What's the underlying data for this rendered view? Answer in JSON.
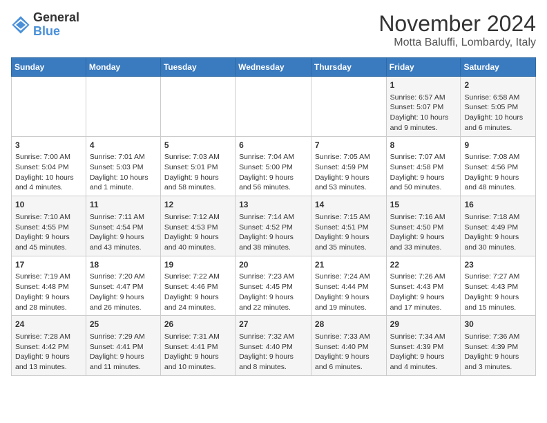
{
  "logo": {
    "line1": "General",
    "line2": "Blue"
  },
  "title": "November 2024",
  "location": "Motta Baluffi, Lombardy, Italy",
  "days_of_week": [
    "Sunday",
    "Monday",
    "Tuesday",
    "Wednesday",
    "Thursday",
    "Friday",
    "Saturday"
  ],
  "weeks": [
    [
      {
        "day": "",
        "info": ""
      },
      {
        "day": "",
        "info": ""
      },
      {
        "day": "",
        "info": ""
      },
      {
        "day": "",
        "info": ""
      },
      {
        "day": "",
        "info": ""
      },
      {
        "day": "1",
        "info": "Sunrise: 6:57 AM\nSunset: 5:07 PM\nDaylight: 10 hours and 9 minutes."
      },
      {
        "day": "2",
        "info": "Sunrise: 6:58 AM\nSunset: 5:05 PM\nDaylight: 10 hours and 6 minutes."
      }
    ],
    [
      {
        "day": "3",
        "info": "Sunrise: 7:00 AM\nSunset: 5:04 PM\nDaylight: 10 hours and 4 minutes."
      },
      {
        "day": "4",
        "info": "Sunrise: 7:01 AM\nSunset: 5:03 PM\nDaylight: 10 hours and 1 minute."
      },
      {
        "day": "5",
        "info": "Sunrise: 7:03 AM\nSunset: 5:01 PM\nDaylight: 9 hours and 58 minutes."
      },
      {
        "day": "6",
        "info": "Sunrise: 7:04 AM\nSunset: 5:00 PM\nDaylight: 9 hours and 56 minutes."
      },
      {
        "day": "7",
        "info": "Sunrise: 7:05 AM\nSunset: 4:59 PM\nDaylight: 9 hours and 53 minutes."
      },
      {
        "day": "8",
        "info": "Sunrise: 7:07 AM\nSunset: 4:58 PM\nDaylight: 9 hours and 50 minutes."
      },
      {
        "day": "9",
        "info": "Sunrise: 7:08 AM\nSunset: 4:56 PM\nDaylight: 9 hours and 48 minutes."
      }
    ],
    [
      {
        "day": "10",
        "info": "Sunrise: 7:10 AM\nSunset: 4:55 PM\nDaylight: 9 hours and 45 minutes."
      },
      {
        "day": "11",
        "info": "Sunrise: 7:11 AM\nSunset: 4:54 PM\nDaylight: 9 hours and 43 minutes."
      },
      {
        "day": "12",
        "info": "Sunrise: 7:12 AM\nSunset: 4:53 PM\nDaylight: 9 hours and 40 minutes."
      },
      {
        "day": "13",
        "info": "Sunrise: 7:14 AM\nSunset: 4:52 PM\nDaylight: 9 hours and 38 minutes."
      },
      {
        "day": "14",
        "info": "Sunrise: 7:15 AM\nSunset: 4:51 PM\nDaylight: 9 hours and 35 minutes."
      },
      {
        "day": "15",
        "info": "Sunrise: 7:16 AM\nSunset: 4:50 PM\nDaylight: 9 hours and 33 minutes."
      },
      {
        "day": "16",
        "info": "Sunrise: 7:18 AM\nSunset: 4:49 PM\nDaylight: 9 hours and 30 minutes."
      }
    ],
    [
      {
        "day": "17",
        "info": "Sunrise: 7:19 AM\nSunset: 4:48 PM\nDaylight: 9 hours and 28 minutes."
      },
      {
        "day": "18",
        "info": "Sunrise: 7:20 AM\nSunset: 4:47 PM\nDaylight: 9 hours and 26 minutes."
      },
      {
        "day": "19",
        "info": "Sunrise: 7:22 AM\nSunset: 4:46 PM\nDaylight: 9 hours and 24 minutes."
      },
      {
        "day": "20",
        "info": "Sunrise: 7:23 AM\nSunset: 4:45 PM\nDaylight: 9 hours and 22 minutes."
      },
      {
        "day": "21",
        "info": "Sunrise: 7:24 AM\nSunset: 4:44 PM\nDaylight: 9 hours and 19 minutes."
      },
      {
        "day": "22",
        "info": "Sunrise: 7:26 AM\nSunset: 4:43 PM\nDaylight: 9 hours and 17 minutes."
      },
      {
        "day": "23",
        "info": "Sunrise: 7:27 AM\nSunset: 4:43 PM\nDaylight: 9 hours and 15 minutes."
      }
    ],
    [
      {
        "day": "24",
        "info": "Sunrise: 7:28 AM\nSunset: 4:42 PM\nDaylight: 9 hours and 13 minutes."
      },
      {
        "day": "25",
        "info": "Sunrise: 7:29 AM\nSunset: 4:41 PM\nDaylight: 9 hours and 11 minutes."
      },
      {
        "day": "26",
        "info": "Sunrise: 7:31 AM\nSunset: 4:41 PM\nDaylight: 9 hours and 10 minutes."
      },
      {
        "day": "27",
        "info": "Sunrise: 7:32 AM\nSunset: 4:40 PM\nDaylight: 9 hours and 8 minutes."
      },
      {
        "day": "28",
        "info": "Sunrise: 7:33 AM\nSunset: 4:40 PM\nDaylight: 9 hours and 6 minutes."
      },
      {
        "day": "29",
        "info": "Sunrise: 7:34 AM\nSunset: 4:39 PM\nDaylight: 9 hours and 4 minutes."
      },
      {
        "day": "30",
        "info": "Sunrise: 7:36 AM\nSunset: 4:39 PM\nDaylight: 9 hours and 3 minutes."
      }
    ]
  ]
}
